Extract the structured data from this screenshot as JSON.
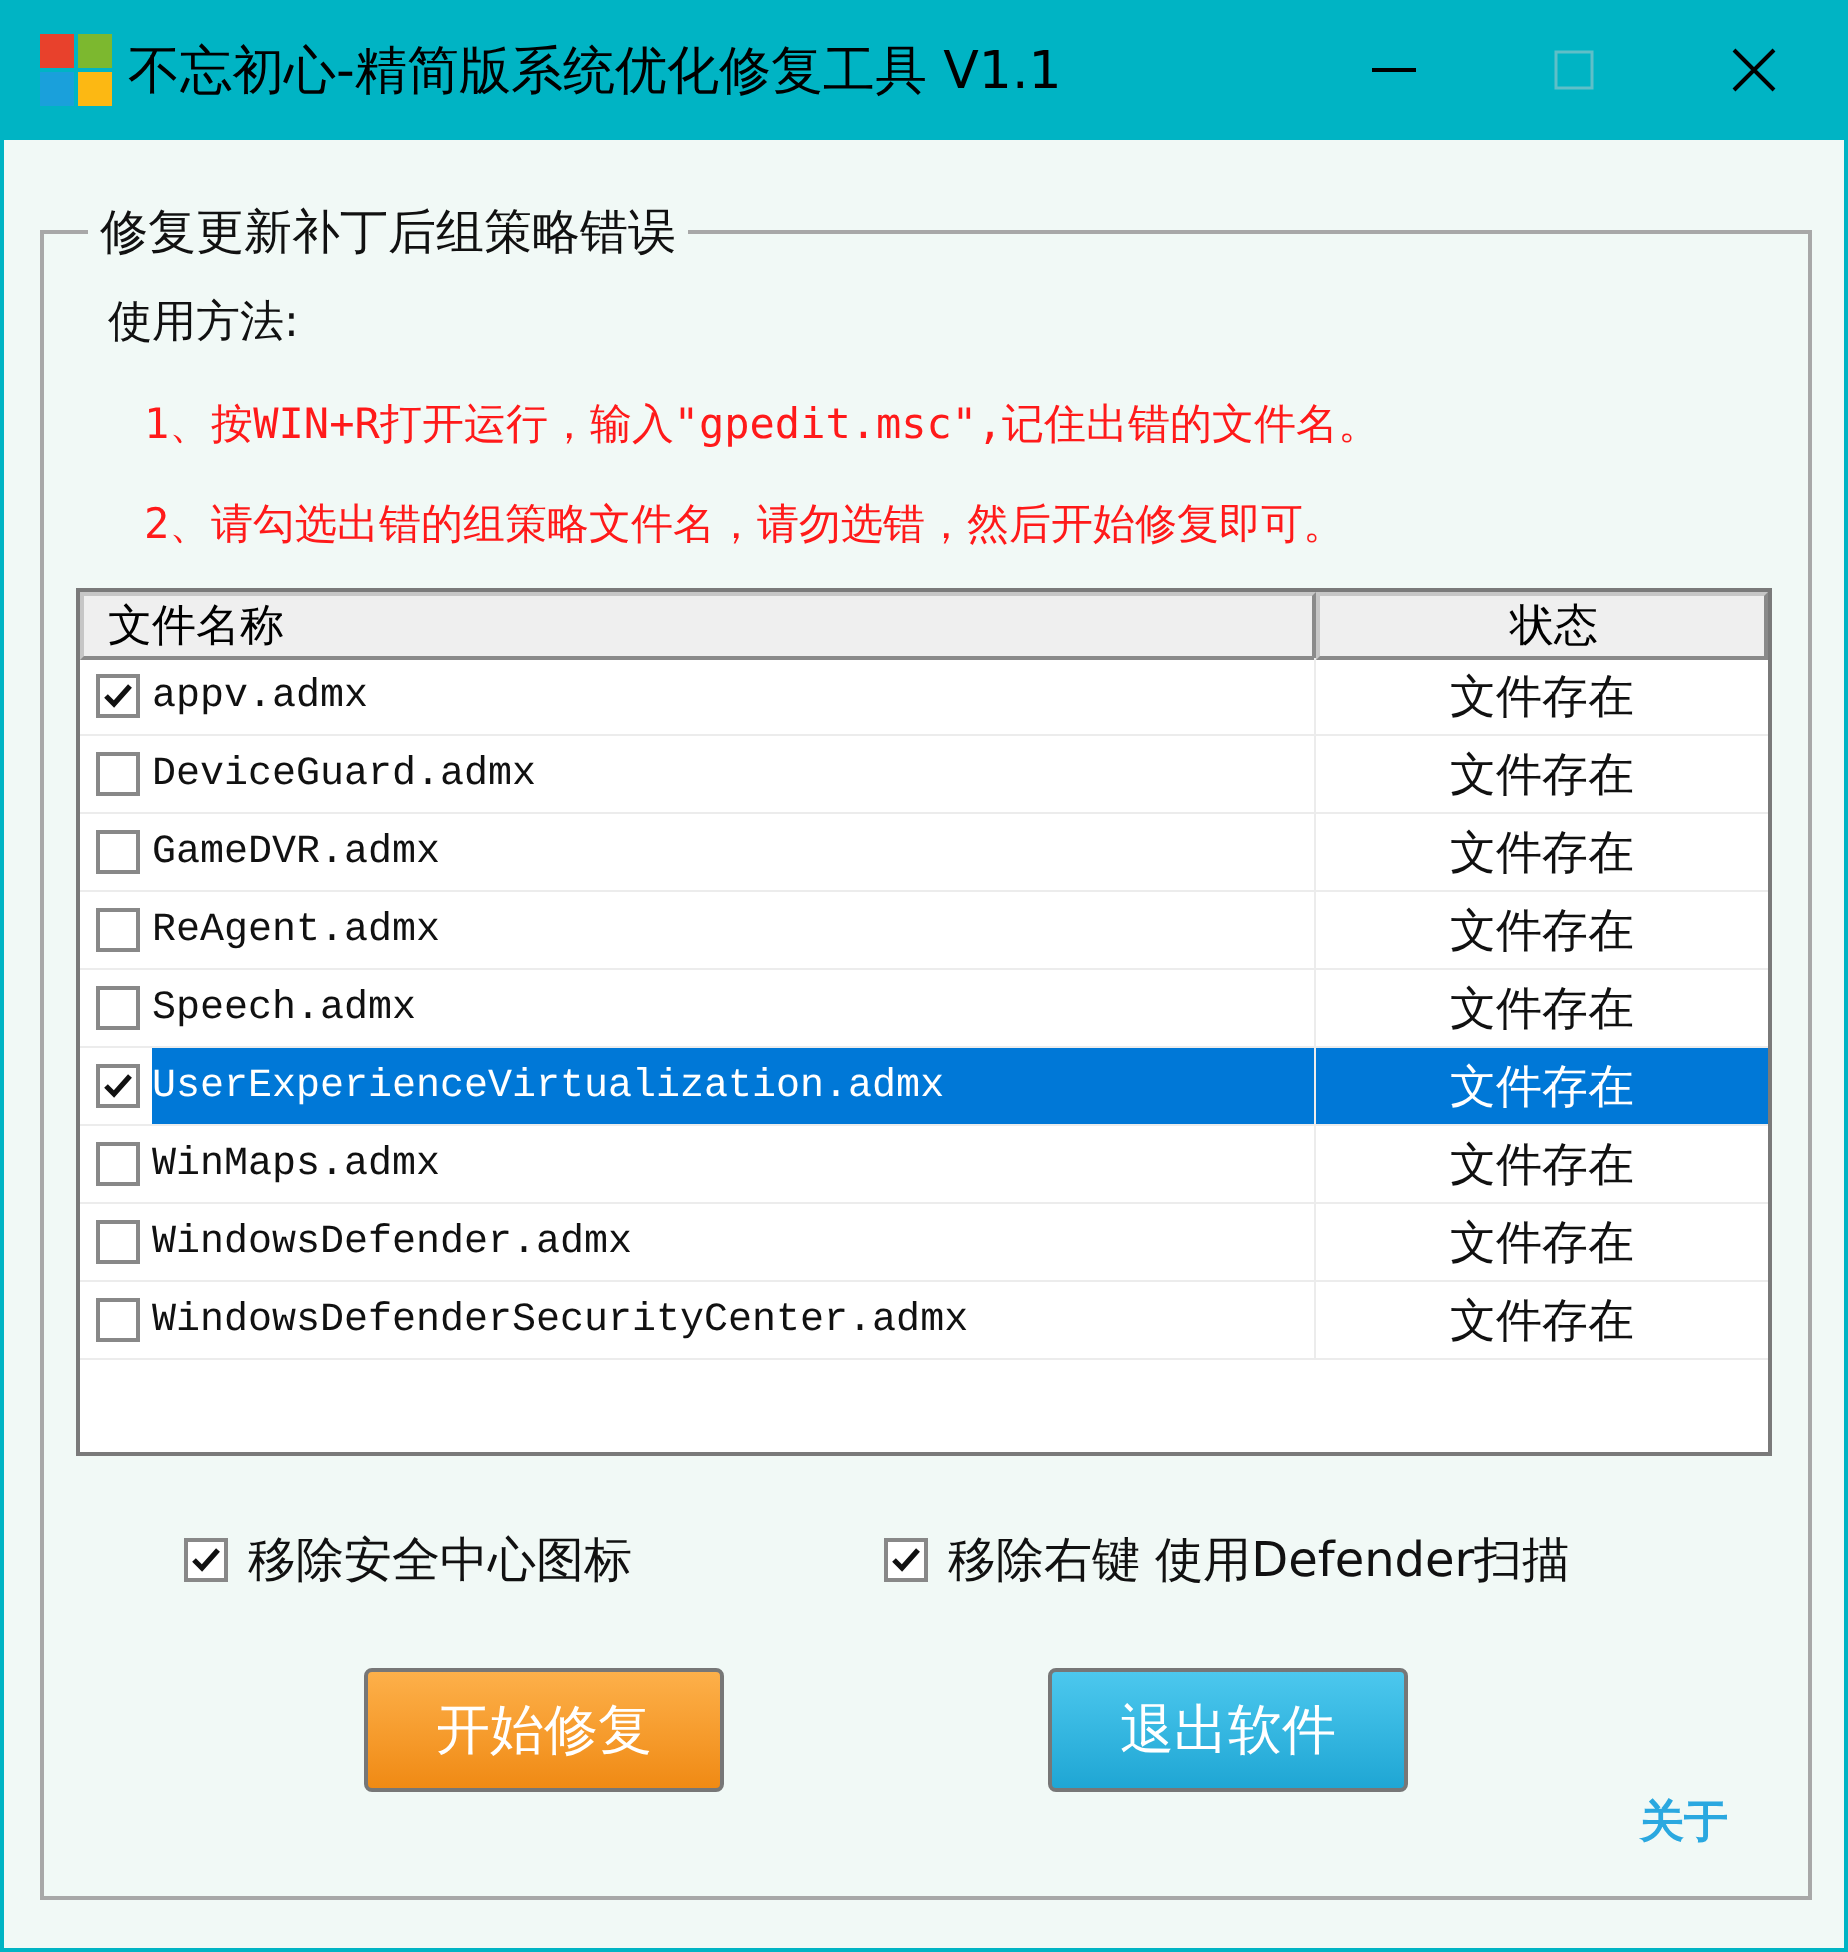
{
  "window": {
    "title": "不忘初心-精简版系统优化修复工具 V1.1"
  },
  "group": {
    "title": "修复更新补丁后组策略错误"
  },
  "usage": {
    "heading": "使用方法:",
    "steps": [
      "1、按WIN+R打开运行，输入\"gpedit.msc\",记住出错的文件名。",
      "2、请勾选出错的组策略文件名，请勿选错，然后开始修复即可。"
    ]
  },
  "table": {
    "columns": [
      "文件名称",
      "状态"
    ],
    "rows": [
      {
        "name": "appv.admx",
        "status": "文件存在",
        "checked": true,
        "selected": false
      },
      {
        "name": "DeviceGuard.admx",
        "status": "文件存在",
        "checked": false,
        "selected": false
      },
      {
        "name": "GameDVR.admx",
        "status": "文件存在",
        "checked": false,
        "selected": false
      },
      {
        "name": "ReAgent.admx",
        "status": "文件存在",
        "checked": false,
        "selected": false
      },
      {
        "name": "Speech.admx",
        "status": "文件存在",
        "checked": false,
        "selected": false
      },
      {
        "name": "UserExperienceVirtualization.admx",
        "status": "文件存在",
        "checked": true,
        "selected": true
      },
      {
        "name": "WinMaps.admx",
        "status": "文件存在",
        "checked": false,
        "selected": false
      },
      {
        "name": "WindowsDefender.admx",
        "status": "文件存在",
        "checked": false,
        "selected": false
      },
      {
        "name": "WindowsDefenderSecurityCenter.admx",
        "status": "文件存在",
        "checked": false,
        "selected": false
      }
    ]
  },
  "options": [
    {
      "label": "移除安全中心图标",
      "checked": true
    },
    {
      "label": "移除右键 使用Defender扫描",
      "checked": true
    }
  ],
  "buttons": [
    {
      "label": "开始修复",
      "kind": "orange"
    },
    {
      "label": "退出软件",
      "kind": "blue"
    }
  ],
  "about_link": "关于"
}
